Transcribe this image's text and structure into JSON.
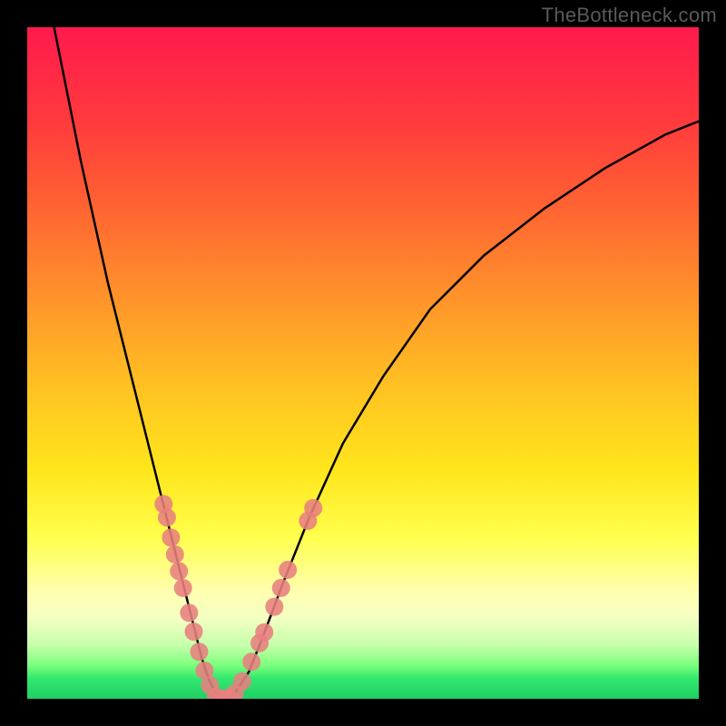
{
  "watermark": "TheBottleneck.com",
  "chart_data": {
    "type": "line",
    "title": "",
    "xlabel": "",
    "ylabel": "",
    "xlim": [
      0,
      100
    ],
    "ylim": [
      0,
      100
    ],
    "curve": {
      "name": "bottleneck-curve",
      "color": "#000000",
      "x": [
        4,
        6,
        8,
        10,
        12,
        14,
        16,
        18,
        20,
        22,
        23,
        24,
        25,
        26,
        27,
        28,
        29,
        30,
        31,
        33,
        35,
        38,
        42,
        47,
        53,
        60,
        68,
        77,
        86,
        95,
        100
      ],
      "y": [
        100,
        90,
        80,
        71,
        62,
        54,
        46,
        38,
        30,
        22,
        18,
        14,
        10,
        6,
        3,
        1,
        0,
        0,
        1,
        4,
        9,
        17,
        27,
        38,
        48,
        58,
        66,
        73,
        79,
        84,
        86
      ]
    },
    "scatter": {
      "name": "sample-points",
      "color": "#e88080",
      "radius_px": 10,
      "points": [
        {
          "x": 20.3,
          "y": 29
        },
        {
          "x": 20.8,
          "y": 27
        },
        {
          "x": 21.4,
          "y": 24
        },
        {
          "x": 22.0,
          "y": 21.5
        },
        {
          "x": 22.6,
          "y": 19
        },
        {
          "x": 23.2,
          "y": 16.5
        },
        {
          "x": 24.1,
          "y": 12.8
        },
        {
          "x": 24.8,
          "y": 10.0
        },
        {
          "x": 25.6,
          "y": 7.0
        },
        {
          "x": 26.4,
          "y": 4.2
        },
        {
          "x": 27.2,
          "y": 2.0
        },
        {
          "x": 28.1,
          "y": 0.3
        },
        {
          "x": 29.0,
          "y": 0.0
        },
        {
          "x": 30.0,
          "y": 0.1
        },
        {
          "x": 30.9,
          "y": 0.8
        },
        {
          "x": 32.0,
          "y": 2.6
        },
        {
          "x": 33.4,
          "y": 5.5
        },
        {
          "x": 34.6,
          "y": 8.3
        },
        {
          "x": 35.3,
          "y": 9.9
        },
        {
          "x": 36.8,
          "y": 13.7
        },
        {
          "x": 37.8,
          "y": 16.5
        },
        {
          "x": 38.8,
          "y": 19.2
        },
        {
          "x": 41.8,
          "y": 26.5
        },
        {
          "x": 42.6,
          "y": 28.4
        }
      ]
    }
  }
}
